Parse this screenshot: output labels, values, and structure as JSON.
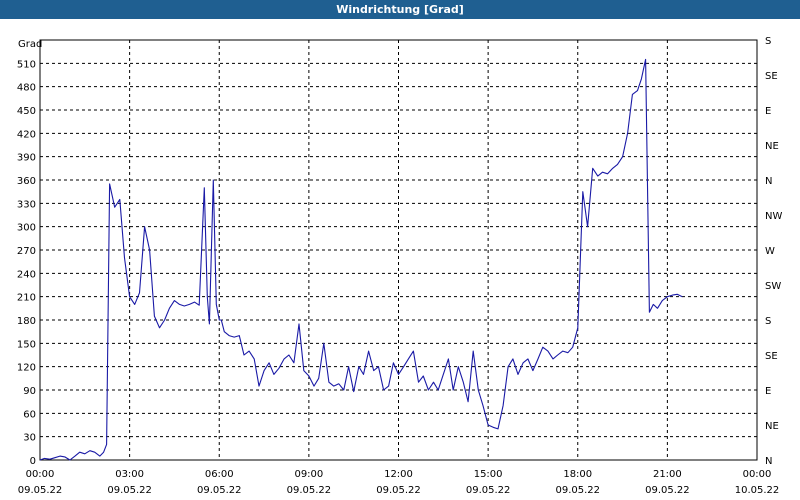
{
  "window": {
    "title": "Windrichtung [Grad]"
  },
  "chart_data": {
    "type": "line",
    "title": "Windrichtung [Grad]",
    "ylabel": "Grad",
    "ylim": [
      0,
      540
    ],
    "yticks": [
      0,
      30,
      60,
      90,
      120,
      150,
      180,
      210,
      240,
      270,
      300,
      330,
      360,
      390,
      420,
      450,
      480,
      510
    ],
    "right_axis_labels": [
      "N",
      "NE",
      "E",
      "SE",
      "S",
      "SW",
      "W",
      "NW",
      "N",
      "NE",
      "E",
      "SE",
      "S"
    ],
    "x_ticks": [
      {
        "time": "00:00",
        "date": "09.05.22"
      },
      {
        "time": "03:00",
        "date": "09.05.22"
      },
      {
        "time": "06:00",
        "date": "09.05.22"
      },
      {
        "time": "09:00",
        "date": "09.05.22"
      },
      {
        "time": "12:00",
        "date": "09.05.22"
      },
      {
        "time": "15:00",
        "date": "09.05.22"
      },
      {
        "time": "18:00",
        "date": "09.05.22"
      },
      {
        "time": "21:00",
        "date": "09.05.22"
      },
      {
        "time": "00:00",
        "date": "10.05.22"
      }
    ],
    "grid": true,
    "line_color": "#1a1aa6",
    "series": [
      {
        "x_hours": [
          0,
          0.15,
          0.33,
          0.5,
          0.67,
          0.83,
          1.0,
          1.17,
          1.33,
          1.5,
          1.67,
          1.83,
          2.0,
          2.13,
          2.23,
          2.33,
          2.5,
          2.67,
          2.83,
          3.0,
          3.17,
          3.33,
          3.5,
          3.67,
          3.83,
          4.0,
          4.17,
          4.33,
          4.5,
          4.67,
          4.83,
          5.0,
          5.17,
          5.33,
          5.5,
          5.6,
          5.67,
          5.8,
          5.9,
          6.0,
          6.07,
          6.17,
          6.33,
          6.5,
          6.67,
          6.83,
          7.0,
          7.17,
          7.33,
          7.5,
          7.67,
          7.83,
          8.0,
          8.17,
          8.33,
          8.5,
          8.67,
          8.83,
          9.0,
          9.17,
          9.33,
          9.5,
          9.67,
          9.83,
          10.0,
          10.17,
          10.33,
          10.5,
          10.67,
          10.83,
          11.0,
          11.17,
          11.33,
          11.5,
          11.67,
          11.83,
          12.0,
          12.17,
          12.33,
          12.5,
          12.67,
          12.83,
          13.0,
          13.17,
          13.33,
          13.5,
          13.67,
          13.83,
          14.0,
          14.17,
          14.33,
          14.5,
          14.67,
          14.83,
          15.0,
          15.17,
          15.33,
          15.5,
          15.67,
          15.83,
          16.0,
          16.17,
          16.33,
          16.5,
          16.67,
          16.83,
          17.0,
          17.17,
          17.33,
          17.5,
          17.67,
          17.83,
          18.0,
          18.17,
          18.33,
          18.5,
          18.67,
          18.83,
          19.0,
          19.17,
          19.33,
          19.5,
          19.67,
          19.83,
          20.0,
          20.13,
          20.27,
          20.4,
          20.53,
          20.67,
          20.83,
          21.0,
          21.17,
          21.33,
          21.5,
          21.67,
          21.83,
          22.0,
          22.17,
          22.33,
          22.5,
          22.67,
          22.83,
          23.0,
          23.17,
          23.33,
          23.5,
          23.67,
          23.83,
          24.0
        ],
        "values": [
          0,
          2,
          1,
          3,
          5,
          4,
          0,
          5,
          10,
          8,
          12,
          10,
          5,
          10,
          20,
          355,
          325,
          335,
          260,
          210,
          200,
          215,
          300,
          270,
          185,
          170,
          180,
          195,
          205,
          200,
          198,
          200,
          203,
          199,
          350,
          210,
          175,
          360,
          200,
          180,
          180,
          165,
          160,
          158,
          160,
          135,
          140,
          130,
          95,
          115,
          125,
          110,
          118,
          130,
          135,
          125,
          175,
          115,
          108,
          95,
          105,
          150,
          100,
          95,
          98,
          90,
          120,
          88,
          120,
          110,
          140,
          115,
          120,
          90,
          95,
          125,
          110,
          120,
          130,
          140,
          100,
          108,
          90,
          100,
          90,
          110,
          130,
          90,
          120,
          100,
          75,
          140,
          90,
          70,
          45,
          42,
          40,
          70,
          120,
          130,
          110,
          125,
          130,
          115,
          130,
          145,
          140,
          130,
          135,
          140,
          138,
          145,
          170,
          345,
          300,
          375,
          365,
          370,
          368,
          375,
          380,
          390,
          420,
          470,
          475,
          490,
          515,
          190,
          200,
          195,
          205,
          210,
          212,
          213,
          210
        ],
        "note_x": "hours from 09.05.22 00:00"
      }
    ]
  }
}
